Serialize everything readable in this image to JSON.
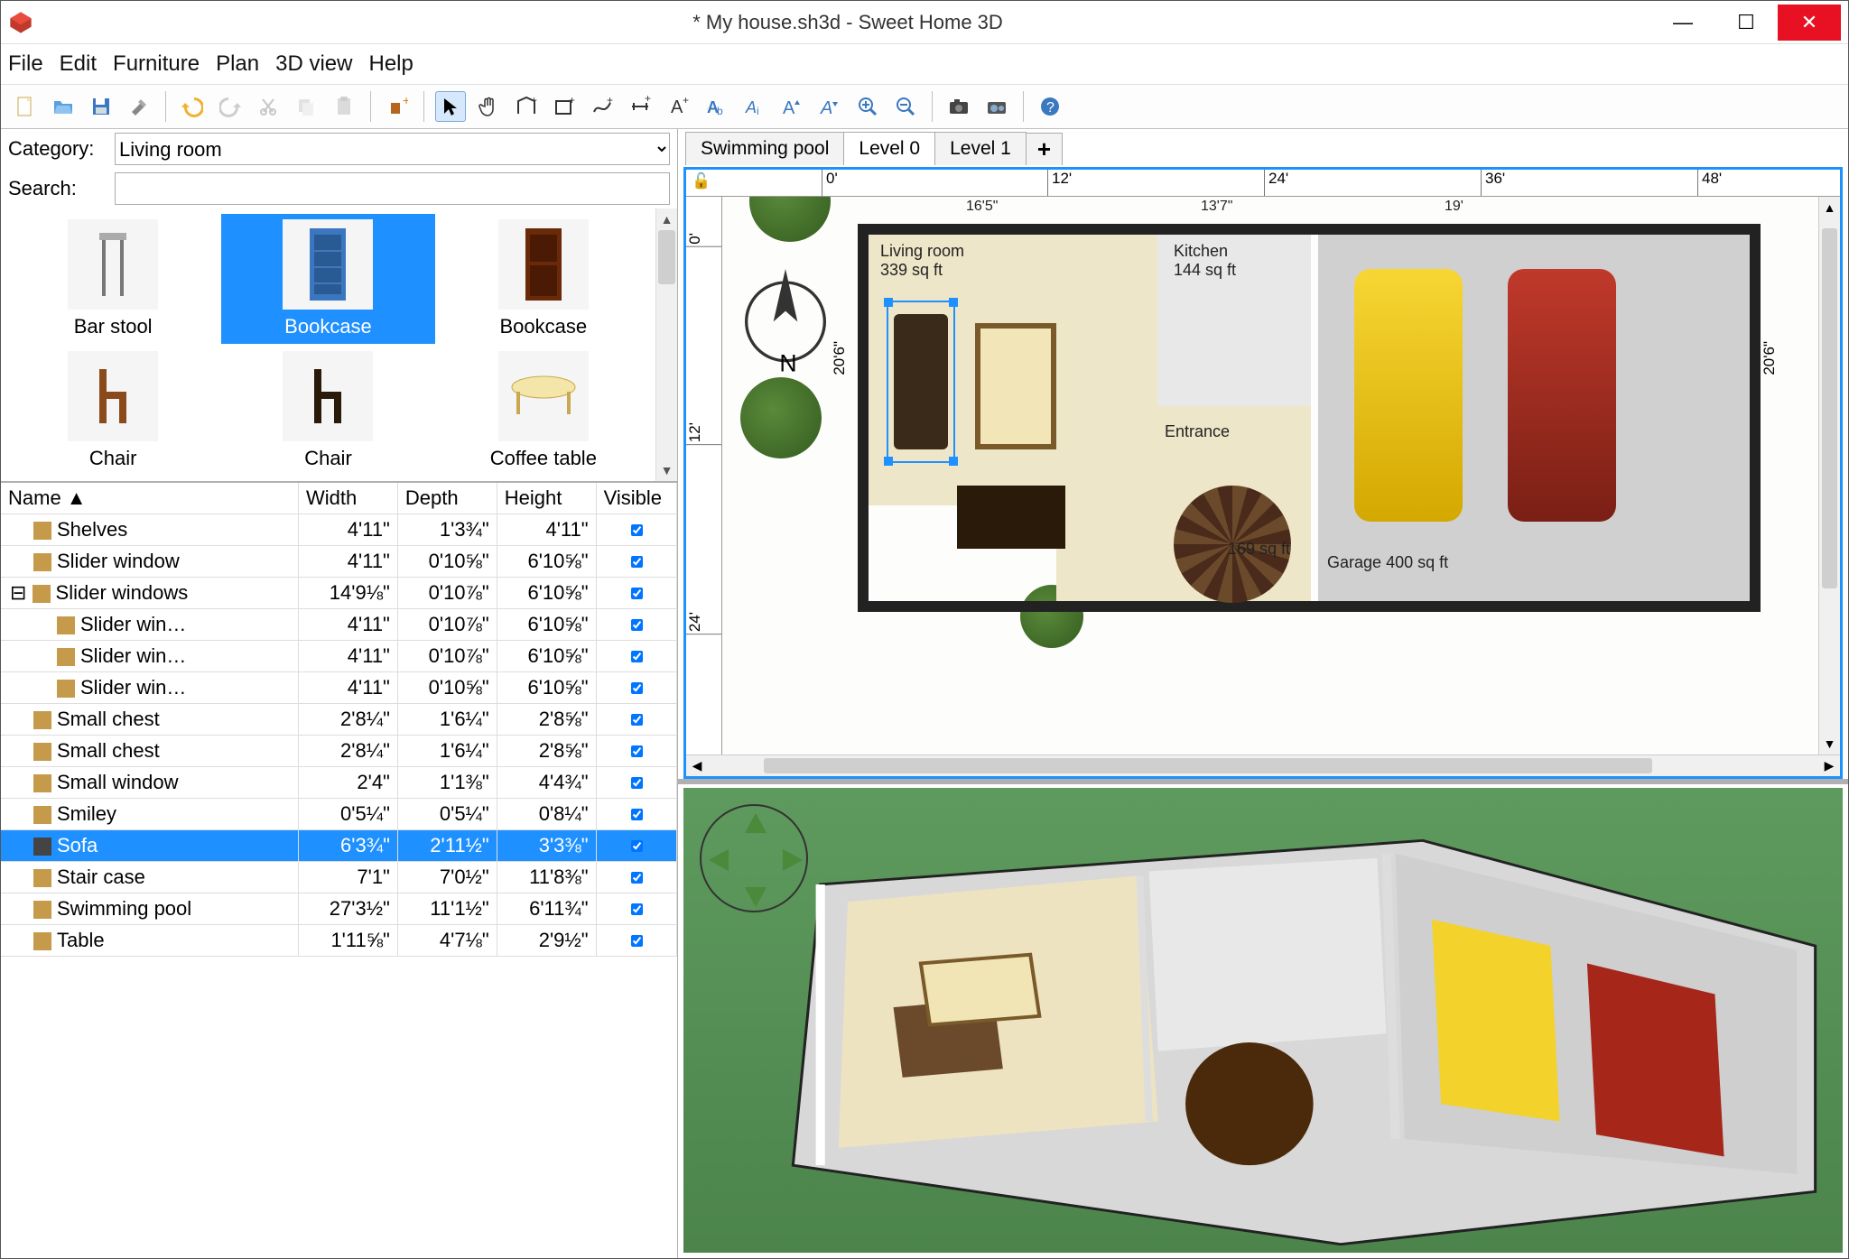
{
  "window": {
    "title": "* My house.sh3d - Sweet Home 3D"
  },
  "menu": [
    "File",
    "Edit",
    "Furniture",
    "Plan",
    "3D view",
    "Help"
  ],
  "catalog": {
    "category_label": "Category:",
    "category_value": "Living room",
    "search_label": "Search:",
    "search_value": "",
    "items": [
      {
        "name": "Bar stool",
        "selected": false
      },
      {
        "name": "Bookcase",
        "selected": true
      },
      {
        "name": "Bookcase",
        "selected": false
      },
      {
        "name": "Chair",
        "selected": false
      },
      {
        "name": "Chair",
        "selected": false
      },
      {
        "name": "Coffee table",
        "selected": false
      }
    ]
  },
  "furniture_table": {
    "columns": [
      "Name",
      "Width",
      "Depth",
      "Height",
      "Visible"
    ],
    "sort_col": 0,
    "rows": [
      {
        "indent": 1,
        "name": "Shelves",
        "w": "4'11\"",
        "d": "1'3¾\"",
        "h": "4'11\"",
        "v": true
      },
      {
        "indent": 1,
        "name": "Slider window",
        "w": "4'11\"",
        "d": "0'10⅝\"",
        "h": "6'10⅝\"",
        "v": true
      },
      {
        "indent": 0,
        "group": true,
        "name": "Slider windows",
        "w": "14'9⅛\"",
        "d": "0'10⅞\"",
        "h": "6'10⅝\"",
        "v": true
      },
      {
        "indent": 2,
        "name": "Slider win…",
        "w": "4'11\"",
        "d": "0'10⅞\"",
        "h": "6'10⅝\"",
        "v": true
      },
      {
        "indent": 2,
        "name": "Slider win…",
        "w": "4'11\"",
        "d": "0'10⅞\"",
        "h": "6'10⅝\"",
        "v": true
      },
      {
        "indent": 2,
        "name": "Slider win…",
        "w": "4'11\"",
        "d": "0'10⅝\"",
        "h": "6'10⅝\"",
        "v": true
      },
      {
        "indent": 1,
        "name": "Small chest",
        "w": "2'8¼\"",
        "d": "1'6¼\"",
        "h": "2'8⅝\"",
        "v": true
      },
      {
        "indent": 1,
        "name": "Small chest",
        "w": "2'8¼\"",
        "d": "1'6¼\"",
        "h": "2'8⅝\"",
        "v": true
      },
      {
        "indent": 1,
        "name": "Small window",
        "w": "2'4\"",
        "d": "1'1⅜\"",
        "h": "4'4¾\"",
        "v": true
      },
      {
        "indent": 1,
        "name": "Smiley",
        "w": "0'5¼\"",
        "d": "0'5¼\"",
        "h": "0'8¼\"",
        "v": true
      },
      {
        "indent": 1,
        "name": "Sofa",
        "w": "6'3¾\"",
        "d": "2'11½\"",
        "h": "3'3⅜\"",
        "v": true,
        "selected": true
      },
      {
        "indent": 1,
        "name": "Stair case",
        "w": "7'1\"",
        "d": "7'0½\"",
        "h": "11'8⅜\"",
        "v": true
      },
      {
        "indent": 1,
        "name": "Swimming pool",
        "w": "27'3½\"",
        "d": "11'1½\"",
        "h": "6'11¾\"",
        "v": true
      },
      {
        "indent": 1,
        "name": "Table",
        "w": "1'11⅝\"",
        "d": "4'7⅛\"",
        "h": "2'9½\"",
        "v": true
      }
    ]
  },
  "plan": {
    "tabs": [
      {
        "label": "Swimming pool",
        "active": false
      },
      {
        "label": "Level 0",
        "active": true
      },
      {
        "label": "Level 1",
        "active": false
      }
    ],
    "ruler_h": [
      "0'",
      "12'",
      "24'",
      "36'",
      "48'"
    ],
    "ruler_v": [
      "0'",
      "12'",
      "24'"
    ],
    "dim_top": [
      "16'5\"",
      "13'7\"",
      "19'"
    ],
    "dim_side": "20'6\"",
    "rooms": [
      {
        "name": "Living room",
        "area": "339 sq ft"
      },
      {
        "name": "Kitchen",
        "area": "144 sq ft"
      },
      {
        "name": "Entrance",
        "area": "169 sq ft"
      },
      {
        "name": "Garage",
        "area": "400 sq ft"
      }
    ],
    "compass_label": "N"
  }
}
